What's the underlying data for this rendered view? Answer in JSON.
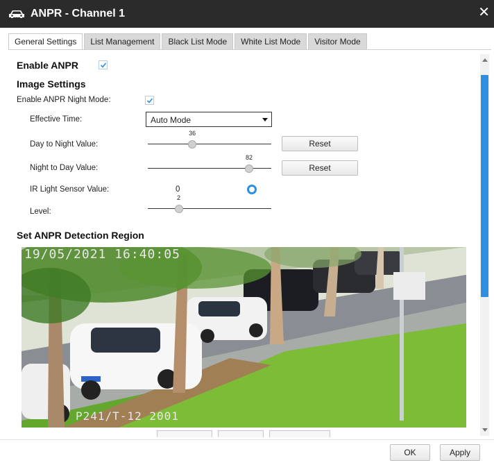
{
  "window": {
    "title": "ANPR - Channel 1",
    "close_label": "✕"
  },
  "tabs": [
    {
      "label": "General Settings",
      "active": true
    },
    {
      "label": "List Management",
      "active": false
    },
    {
      "label": "Black List Mode",
      "active": false
    },
    {
      "label": "White List Mode",
      "active": false
    },
    {
      "label": "Visitor Mode",
      "active": false
    }
  ],
  "enable_anpr": {
    "label": "Enable ANPR",
    "checked": true
  },
  "image_settings": {
    "title": "Image Settings",
    "night_mode": {
      "label": "Enable ANPR Night Mode:",
      "checked": true
    },
    "effective_time": {
      "label": "Effective Time:",
      "value": "Auto Mode"
    },
    "day_to_night": {
      "label": "Day to Night Value:",
      "value": 36,
      "fraction": 0.36,
      "reset_label": "Reset"
    },
    "night_to_day": {
      "label": "Night to Day Value:",
      "value": 82,
      "fraction": 0.82,
      "reset_label": "Reset"
    },
    "ir_sensor": {
      "label": "IR Light Sensor Value:",
      "value": "0"
    },
    "level": {
      "label": "Level:",
      "value": 2,
      "fraction": 0.25
    }
  },
  "detection": {
    "title": "Set ANPR Detection Region",
    "osd_time": "19/05/2021 16:40:05",
    "osd_label": "P241/T-12 2001"
  },
  "footer": {
    "ok_label": "OK",
    "apply_label": "Apply"
  },
  "colors": {
    "accent": "#2e8fe0",
    "titlebar": "#2b2b2b",
    "tab_inactive": "#d9d9d9"
  }
}
